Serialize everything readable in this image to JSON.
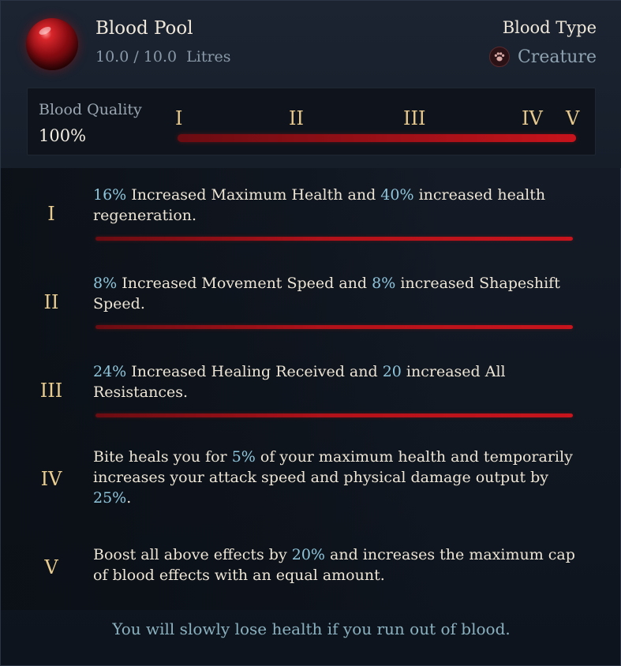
{
  "header": {
    "title": "Blood Pool",
    "amount_current": "10.0 / 10.0",
    "amount_unit": "Litres",
    "blood_type_label": "Blood Type",
    "blood_type_value": "Creature",
    "blood_type_icon": "paw-icon",
    "orb_icon": "blood-orb-icon"
  },
  "quality": {
    "label": "Blood Quality",
    "value": "100%",
    "fill_fraction": 1.0,
    "tiers": [
      "I",
      "II",
      "III",
      "IV",
      "V"
    ]
  },
  "tiers": [
    {
      "numeral": "I",
      "parts": [
        [
          "16%",
          true
        ],
        [
          " Increased Maximum Health and ",
          false
        ],
        [
          "40%",
          true
        ],
        [
          " increased health regeneration.",
          false
        ]
      ],
      "progress": 1.0
    },
    {
      "numeral": "II",
      "parts": [
        [
          "8%",
          true
        ],
        [
          " Increased Movement Speed and ",
          false
        ],
        [
          "8%",
          true
        ],
        [
          " increased Shapeshift Speed.",
          false
        ]
      ],
      "progress": 1.0
    },
    {
      "numeral": "III",
      "parts": [
        [
          "24%",
          true
        ],
        [
          " Increased Healing Received and ",
          false
        ],
        [
          "20",
          true
        ],
        [
          " increased All Resistances.",
          false
        ]
      ],
      "progress": 1.0
    },
    {
      "numeral": "IV",
      "parts": [
        [
          "Bite heals you for ",
          false
        ],
        [
          "5%",
          true
        ],
        [
          " of your maximum health and temporarily increases your attack speed and physical damage output by ",
          false
        ],
        [
          "25%",
          true
        ],
        [
          ".",
          false
        ]
      ],
      "progress": null
    },
    {
      "numeral": "V",
      "parts": [
        [
          "Boost all above effects by ",
          false
        ],
        [
          "20%",
          true
        ],
        [
          " and increases the maximum cap of blood effects with an equal amount.",
          false
        ]
      ],
      "progress": null
    }
  ],
  "footer": "You will slowly lose health if you run out of blood.",
  "colors": {
    "accent_highlight": "#8fc6dc",
    "numeral_gold": "#e8cc90",
    "blood_red": "#c8141c"
  }
}
